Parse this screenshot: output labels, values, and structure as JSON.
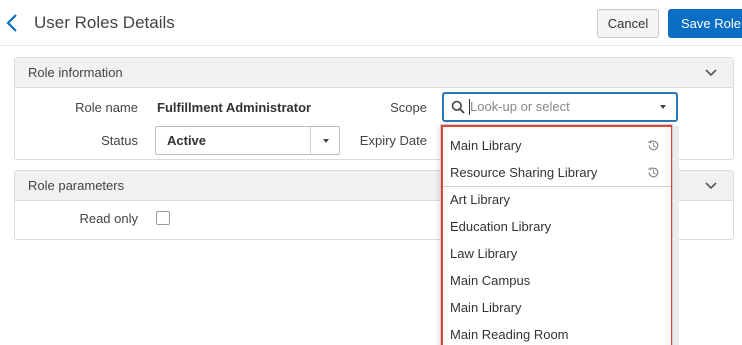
{
  "header": {
    "title": "User Roles Details",
    "cancel_label": "Cancel",
    "save_label": "Save Role"
  },
  "role_information": {
    "title": "Role information",
    "role_name_label": "Role name",
    "role_name_value": "Fulfillment Administrator",
    "status_label": "Status",
    "status_value": "Active",
    "scope_label": "Scope",
    "scope_placeholder": "Look-up or select",
    "expiry_label": "Expiry Date"
  },
  "role_parameters": {
    "title": "Role parameters",
    "read_only_label": "Read only",
    "read_only_checked": false
  },
  "scope_dropdown": {
    "recent": [
      {
        "label": "Main Library",
        "icon": "history-icon"
      },
      {
        "label": "Resource Sharing Library",
        "icon": "history-icon"
      }
    ],
    "options": [
      "Art Library",
      "Education Library",
      "Law Library",
      "Main Campus",
      "Main Library",
      "Main Reading Room"
    ]
  },
  "colors": {
    "primary": "#0a6ec4",
    "focus": "#2a77b6",
    "highlight": "#d9453b"
  }
}
